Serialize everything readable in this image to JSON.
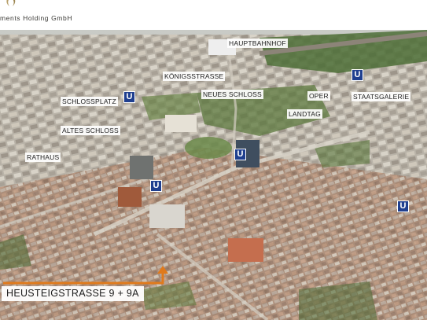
{
  "header": {
    "company_name": "ments Holding GmbH"
  },
  "landmarks": {
    "hauptbahnhof": "HAUPTBAHNHOF",
    "koenigsstrasse": "KÖNIGSSTRASSE",
    "neues_schloss": "NEUES SCHLOSS",
    "schlossplatz": "SCHLOSSPLATZ",
    "oper": "OPER",
    "staatsgalerie": "STAATSGALERIE",
    "landtag": "LANDTAG",
    "altes_schloss": "ALTES SCHLOSS",
    "rathaus": "RATHAUS"
  },
  "ubahn_symbol": "U",
  "address": "HEUSTEIGSTRASSE 9 + 9A",
  "colors": {
    "ubahn": "#1f3f8f",
    "marker": "#e07a1c",
    "label_bg": "#ffffff"
  }
}
